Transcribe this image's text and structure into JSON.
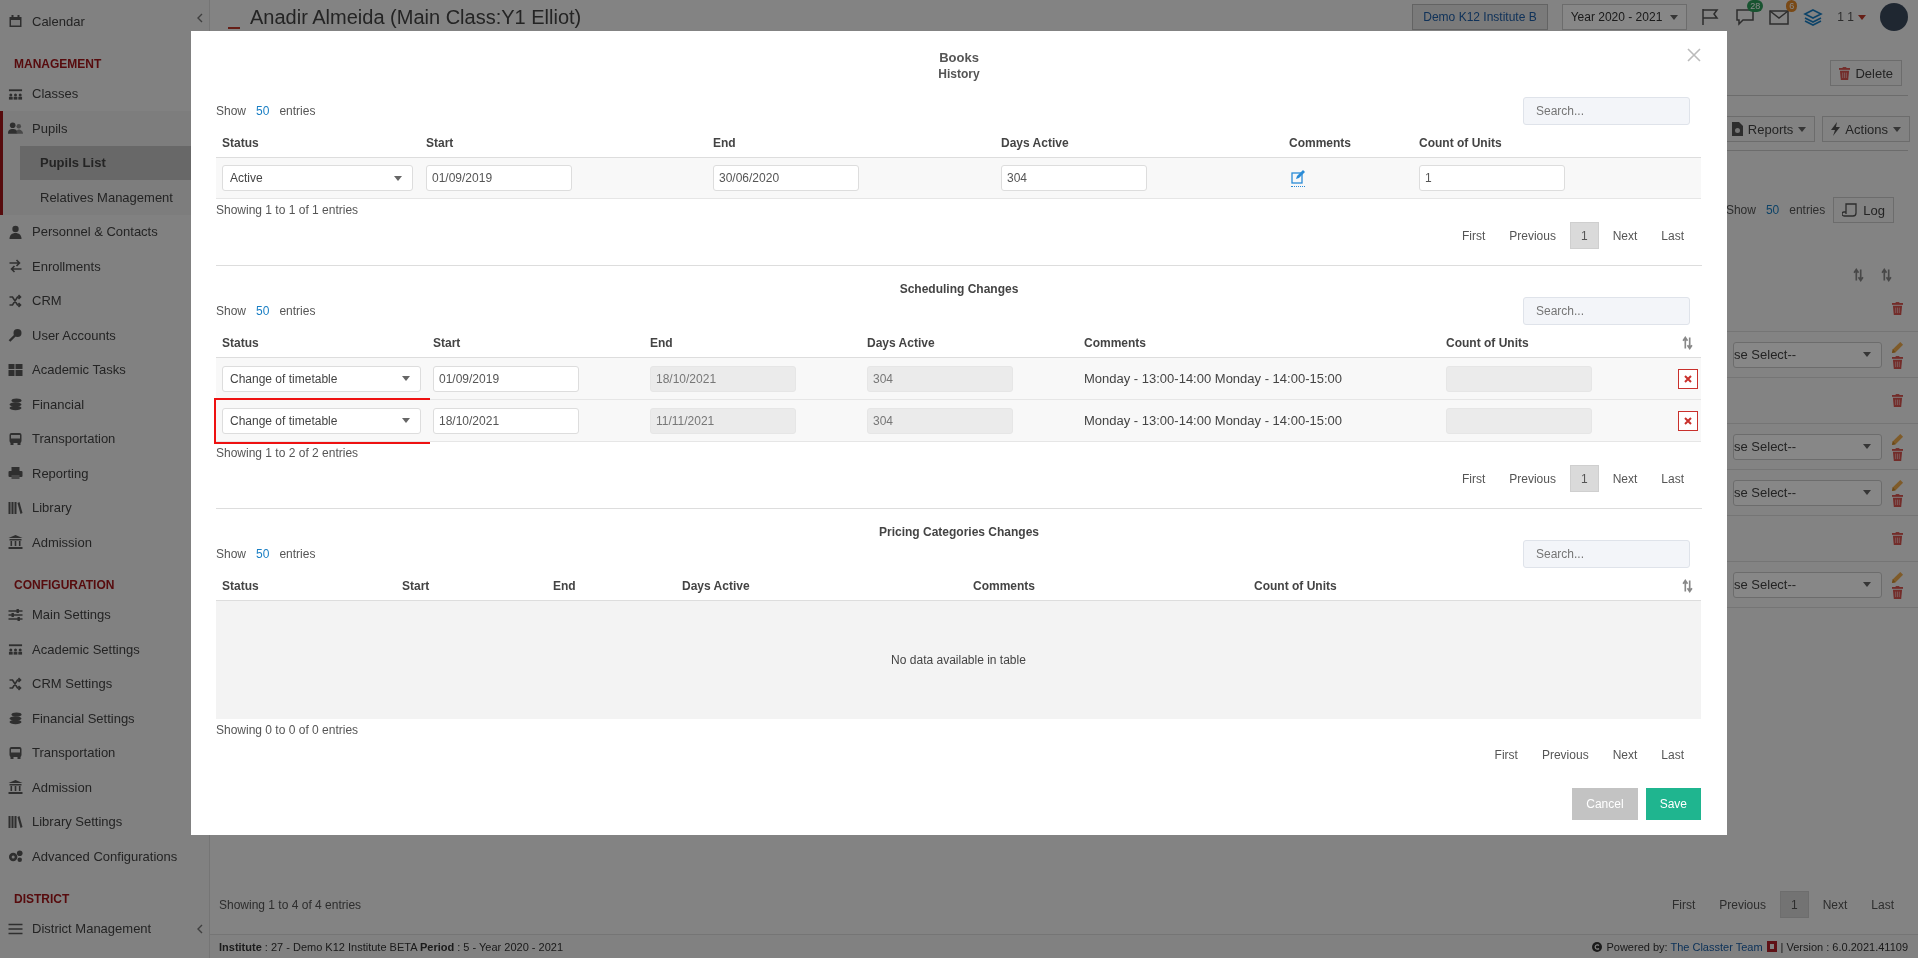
{
  "sidebar": {
    "items": [
      {
        "kind": "link",
        "label": "Calendar"
      },
      {
        "kind": "heading",
        "label": "MANAGEMENT"
      },
      {
        "kind": "link",
        "label": "Classes"
      },
      {
        "kind": "group",
        "label": "Pupils",
        "expanded": true,
        "children": [
          {
            "label": "Pupils List",
            "selected": true
          },
          {
            "label": "Relatives Management",
            "selected": false
          }
        ]
      },
      {
        "kind": "link",
        "label": "Personnel & Contacts"
      },
      {
        "kind": "link",
        "label": "Enrollments"
      },
      {
        "kind": "link",
        "label": "CRM"
      },
      {
        "kind": "link",
        "label": "User Accounts"
      },
      {
        "kind": "link",
        "label": "Academic Tasks"
      },
      {
        "kind": "link",
        "label": "Financial"
      },
      {
        "kind": "link",
        "label": "Transportation"
      },
      {
        "kind": "link",
        "label": "Reporting"
      },
      {
        "kind": "link",
        "label": "Library"
      },
      {
        "kind": "link",
        "label": "Admission"
      },
      {
        "kind": "heading",
        "label": "CONFIGURATION"
      },
      {
        "kind": "link",
        "label": "Main Settings"
      },
      {
        "kind": "link",
        "label": "Academic Settings"
      },
      {
        "kind": "link",
        "label": "CRM Settings"
      },
      {
        "kind": "link",
        "label": "Financial Settings"
      },
      {
        "kind": "link",
        "label": "Transportation"
      },
      {
        "kind": "link",
        "label": "Admission"
      },
      {
        "kind": "link",
        "label": "Library Settings"
      },
      {
        "kind": "link",
        "label": "Advanced Configurations"
      },
      {
        "kind": "heading",
        "label": "DISTRICT"
      },
      {
        "kind": "group",
        "label": "District Management",
        "expanded": false
      }
    ]
  },
  "header": {
    "title": "Anadir Almeida (Main Class:Y1 Elliot)",
    "institute": "Demo K12 Institute B",
    "year": "Year 2020 - 2021",
    "chat_badge": "28",
    "mail_badge": "6",
    "user_label": "1 1"
  },
  "page": {
    "delete_button": "Delete",
    "reports_button": "Reports",
    "actions_button": "Actions",
    "show_label": "Show",
    "page_length": "50",
    "entries_label": "entries",
    "log_button": "Log",
    "rows": [
      {
        "kind": "delete"
      },
      {
        "kind": "select",
        "placeholder": "se Select--"
      },
      {
        "kind": "delete"
      },
      {
        "kind": "select",
        "placeholder": "se Select--"
      },
      {
        "kind": "select",
        "placeholder": "se Select--"
      },
      {
        "kind": "delete"
      },
      {
        "kind": "select",
        "placeholder": "se Select--"
      }
    ],
    "info": "Showing 1 to 4 of 4 entries",
    "pagination": [
      {
        "label": "First",
        "selected": false
      },
      {
        "label": "Previous",
        "selected": false
      },
      {
        "label": "1",
        "selected": true
      },
      {
        "label": "Next",
        "selected": false
      },
      {
        "label": "Last",
        "selected": false
      }
    ]
  },
  "footer": {
    "info": "**Institute** : 27 - Demo K12 Institute BETA **Period** : 5 - Year 2020 - 2021",
    "powered_label": "Powered by:",
    "powered_link": "The Classter Team",
    "version": "| Version : 6.0.2021.41109"
  },
  "modal": {
    "title": "Books",
    "subtitle": "History",
    "sections": [
      {
        "show_label": "Show",
        "page_length": "50",
        "entries_label": "entries",
        "search_placeholder": "Search...",
        "columns": [
          "Status",
          "Start",
          "End",
          "Days Active",
          "Comments",
          "Count of Units"
        ],
        "rows": [
          {
            "highlighted": false,
            "cells": [
              {
                "kind": "select",
                "value": "Active"
              },
              {
                "kind": "input",
                "value": "01/09/2019"
              },
              {
                "kind": "input",
                "value": "30/06/2020"
              },
              {
                "kind": "input",
                "value": "304"
              },
              {
                "kind": "edit"
              },
              {
                "kind": "input",
                "value": "1"
              }
            ]
          }
        ],
        "info": "Showing 1 to 1 of 1 entries",
        "pagination": [
          {
            "label": "First",
            "selected": false
          },
          {
            "label": "Previous",
            "selected": false
          },
          {
            "label": "1",
            "selected": true
          },
          {
            "label": "Next",
            "selected": false
          },
          {
            "label": "Last",
            "selected": false
          }
        ]
      },
      {
        "title": "Scheduling Changes",
        "show_label": "Show",
        "page_length": "50",
        "entries_label": "entries",
        "search_placeholder": "Search...",
        "sortable": true,
        "columns": [
          "Status",
          "Start",
          "End",
          "Days Active",
          "Comments",
          "Count of Units"
        ],
        "rows": [
          {
            "highlighted": false,
            "cells": [
              {
                "kind": "select",
                "value": "Change of timetable"
              },
              {
                "kind": "input",
                "value": "01/09/2019"
              },
              {
                "kind": "readonly",
                "value": "18/10/2021"
              },
              {
                "kind": "readonly",
                "value": "304"
              },
              {
                "kind": "text",
                "value": "Monday - 13:00-14:00 Monday - 14:00-15:00"
              },
              {
                "kind": "readonly"
              },
              {
                "kind": "remove"
              }
            ]
          },
          {
            "highlighted": true,
            "cells": [
              {
                "kind": "select",
                "value": "Change of timetable"
              },
              {
                "kind": "input",
                "value": "18/10/2021"
              },
              {
                "kind": "readonly",
                "value": "11/11/2021"
              },
              {
                "kind": "readonly",
                "value": "304"
              },
              {
                "kind": "text",
                "value": "Monday - 13:00-14:00 Monday - 14:00-15:00"
              },
              {
                "kind": "readonly"
              },
              {
                "kind": "remove"
              }
            ]
          }
        ],
        "info": "Showing 1 to 2 of 2 entries",
        "pagination": [
          {
            "label": "First",
            "selected": false
          },
          {
            "label": "Previous",
            "selected": false
          },
          {
            "label": "1",
            "selected": true
          },
          {
            "label": "Next",
            "selected": false
          },
          {
            "label": "Last",
            "selected": false
          }
        ]
      },
      {
        "title": "Pricing Categories Changes",
        "show_label": "Show",
        "page_length": "50",
        "entries_label": "entries",
        "search_placeholder": "Search...",
        "sortable": true,
        "columns": [
          "Status",
          "Start",
          "End",
          "Days Active",
          "Comments",
          "Count of Units"
        ],
        "empty_message": "No data available in table",
        "info": "Showing 0 to 0 of 0 entries",
        "pagination": [
          {
            "label": "First",
            "selected": false
          },
          {
            "label": "Previous",
            "selected": false
          },
          {
            "label": "Next",
            "selected": false
          },
          {
            "label": "Last",
            "selected": false
          }
        ]
      }
    ],
    "buttons": [
      {
        "kind": "cancel",
        "label": "Cancel"
      },
      {
        "kind": "save",
        "label": "Save"
      }
    ]
  }
}
